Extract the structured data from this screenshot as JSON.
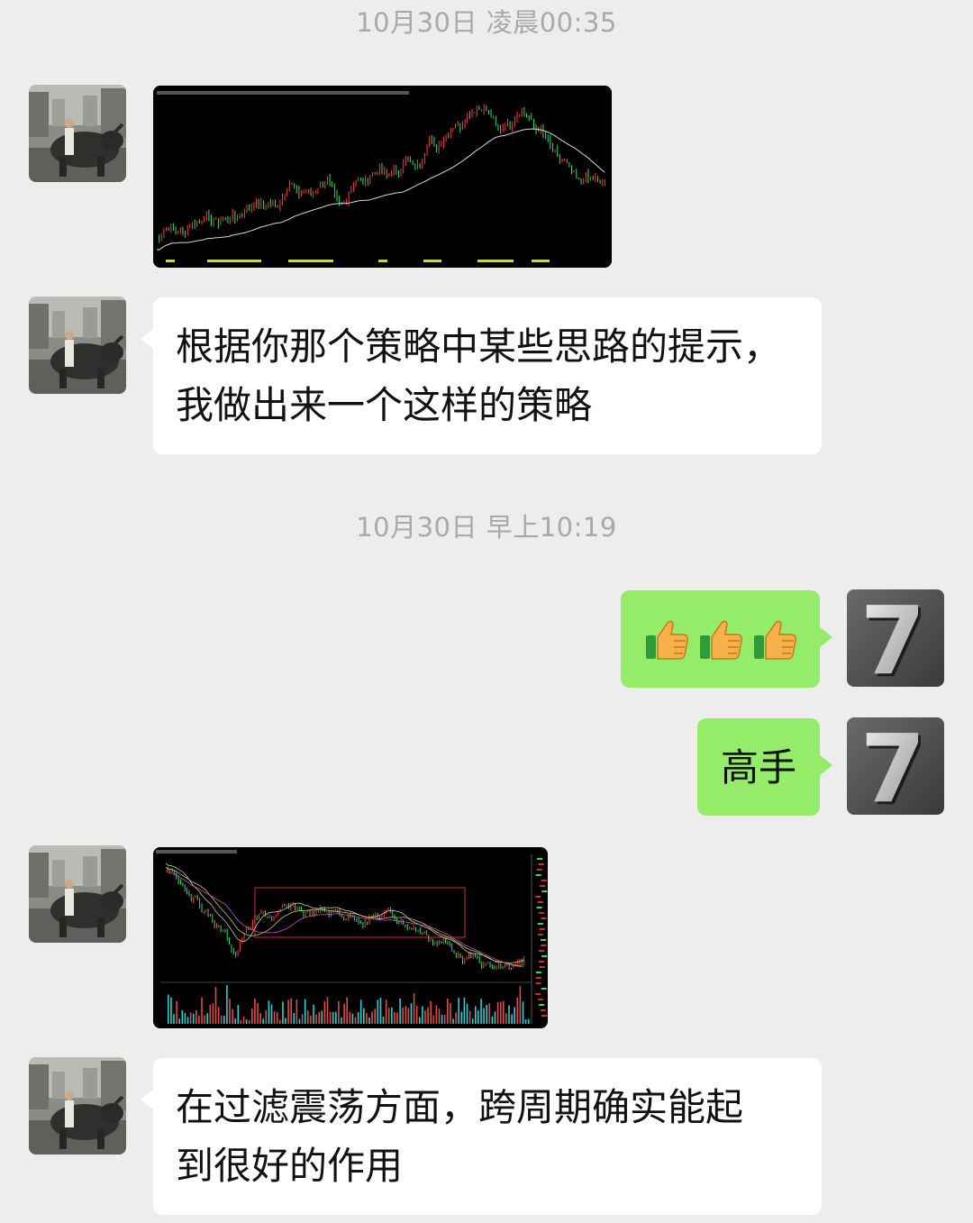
{
  "timestamps": {
    "first": "10月30日 凌晨00:35",
    "second": "10月30日 早上10:19"
  },
  "messages": {
    "m1_image": {
      "sender": "contact",
      "icon": "candlestick-chart-image"
    },
    "m2_text": {
      "sender": "contact",
      "line1": "根据你那个策略中某些思路的提示，",
      "line2": "我做出来一个这样的策略"
    },
    "m3_emoji": {
      "sender": "me",
      "icons": [
        "thumbs-up-icon",
        "thumbs-up-icon",
        "thumbs-up-icon"
      ]
    },
    "m4_text": {
      "sender": "me",
      "text": "高手"
    },
    "m5_image": {
      "sender": "contact",
      "icon": "trading-range-chart-image"
    },
    "m6_text": {
      "sender": "contact",
      "line1": "在过滤震荡方面，跨周期确实能起",
      "line2": "到很好的作用"
    }
  },
  "avatars": {
    "contact": {
      "icon": "bull-statue-avatar"
    },
    "me": {
      "icon": "number-seven-avatar",
      "glyph": "7"
    }
  },
  "colors": {
    "background": "#ededed",
    "bubble_left": "#ffffff",
    "bubble_right": "#95ec69",
    "timestamp": "#a9a9a9",
    "candle_up": "#ff3b3b",
    "candle_down": "#2ee06a"
  }
}
